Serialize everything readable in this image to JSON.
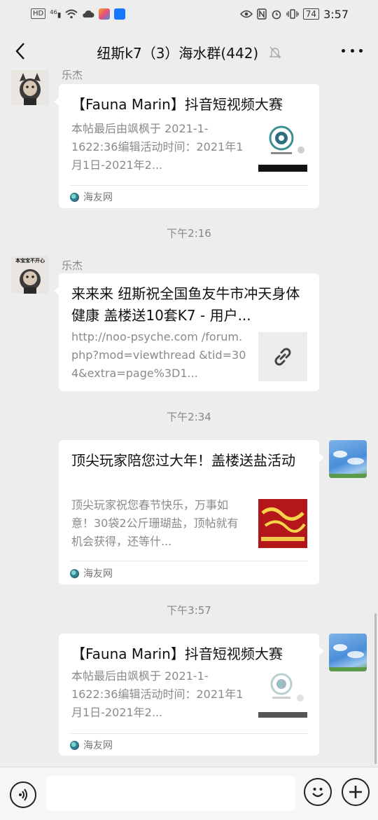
{
  "status_bar": {
    "left_badges": [
      "HD",
      "46"
    ],
    "battery": "74",
    "time": "3:57"
  },
  "header": {
    "title": "纽斯k7（3）海水群(442)",
    "back_icon": "chevron-left-icon",
    "mute_icon": "bell-off-icon",
    "more_icon": "ellipsis-icon"
  },
  "messages": [
    {
      "sender": "乐杰",
      "title": "【Fauna Marin】抖音短视频大赛",
      "desc": "本帖最后由飒枫于 2021-1-1622:36编辑活动时间：2021年1月1日-2021年2...",
      "source": "海友网"
    },
    {
      "time": "下午2:16",
      "sender": "乐杰",
      "avatar_caption": "本宝宝不开心",
      "title": "来来来 纽斯祝全国鱼友牛市冲天身体健康 盖楼送10套K7 - 用户...",
      "desc": "http://noo-psyche.com /forum.php?mod=viewthread &tid=304&extra=page%3D1..."
    },
    {
      "time": "下午2:34",
      "title": "顶尖玩家陪您过大年！盖楼送盐活动",
      "desc": "顶尖玩家祝您春节快乐，万事如意！30袋2公斤珊瑚盐，顶帖就有机会获得，还等什...",
      "source": "海友网"
    },
    {
      "time": "下午3:57",
      "title": "【Fauna Marin】抖音短视频大赛",
      "desc": "本帖最后由飒枫于 2021-1-1622:36编辑活动时间：2021年1月1日-2021年2...",
      "source": "海友网"
    }
  ],
  "input_bar": {
    "voice_icon": "voice-icon",
    "emoji_icon": "emoji-icon",
    "plus_icon": "plus-icon",
    "placeholder": ""
  }
}
